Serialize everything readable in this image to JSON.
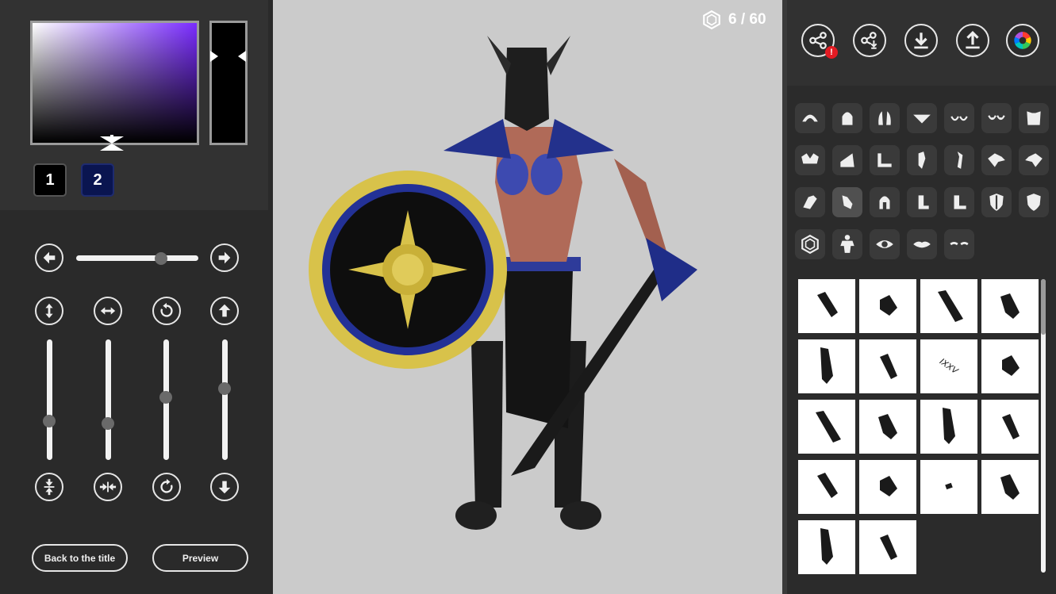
{
  "color_picker": {
    "slots": [
      "1",
      "2"
    ],
    "sv_hue": "#7a2cff",
    "hue_value": "#000000",
    "slot_colors": [
      "#000000",
      "#0a1550"
    ]
  },
  "transform": {
    "slider_value": 0.72,
    "vertical_sliders": [
      0.3,
      0.28,
      0.52,
      0.6
    ]
  },
  "buttons": {
    "back_label": "Back to the title",
    "preview_label": "Preview"
  },
  "stage": {
    "background": "#cbcbcb",
    "counter_text": "6 / 60"
  },
  "toolbar": {
    "icons": [
      "share-icon",
      "share-import-icon",
      "download-icon",
      "upload-icon",
      "color-wheel-icon"
    ],
    "share_badge": "!"
  },
  "categories": {
    "selected": "gloves",
    "items": [
      "hair-front",
      "hair-back",
      "hair-side",
      "chest",
      "bra",
      "bra-alt",
      "torso-armor",
      "shoulder-pads",
      "shoulder-plate",
      "shoulder-armor",
      "arm",
      "arm-alt",
      "hand-left",
      "hand-right",
      "gauntlet",
      "gloves",
      "helmet",
      "boots",
      "boots-alt",
      "shield-left",
      "shield-right",
      "hexagon-marks",
      "body",
      "eye",
      "lips",
      "eyebrows"
    ]
  },
  "items": {
    "count": 18,
    "text_item": "IXXV"
  }
}
